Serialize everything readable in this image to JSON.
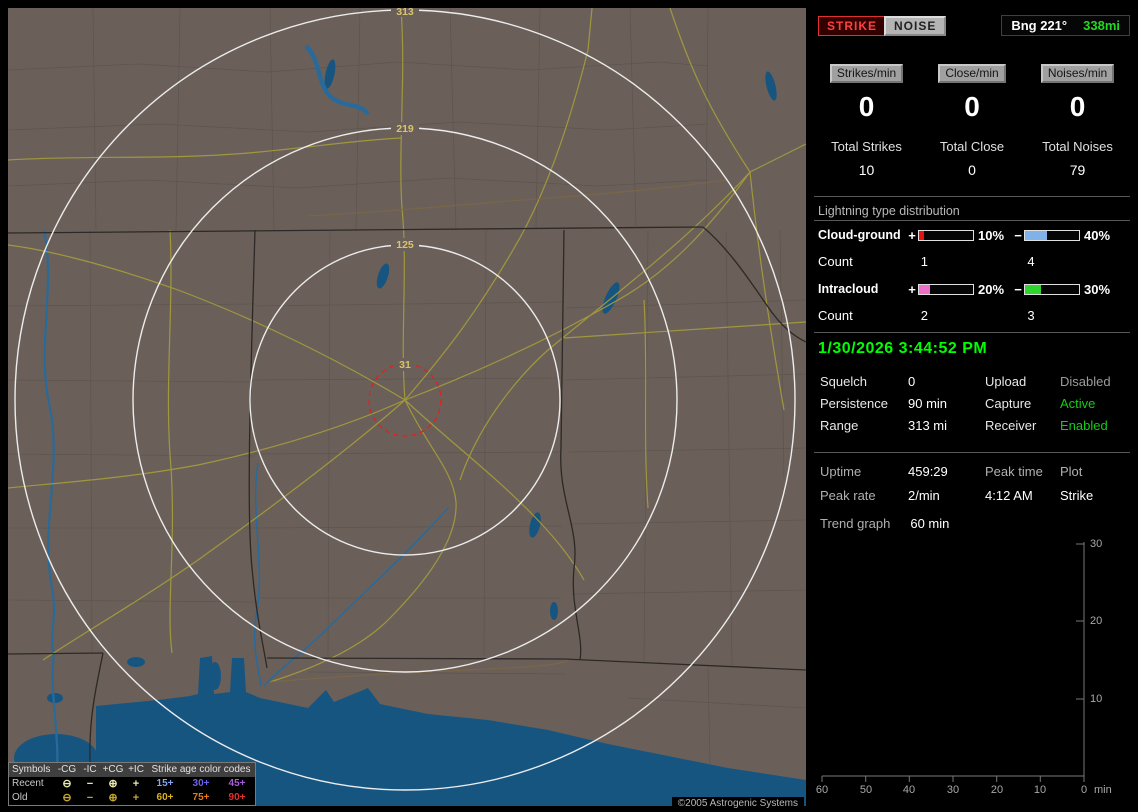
{
  "map": {
    "ring_labels": [
      "313",
      "219",
      "125",
      "31"
    ],
    "copyright": "©2005 Astrogenic Systems",
    "legend": {
      "headers": [
        "Symbols",
        "-CG",
        "-IC",
        "+CG",
        "+IC",
        "Strike age color codes"
      ],
      "rows": [
        {
          "label": "Recent",
          "sym_color": "#e9e9b0",
          "symbols": [
            "⊖",
            "−",
            "⊕",
            "+"
          ],
          "ages": [
            {
              "text": "15+",
              "color": "#86a7f0"
            },
            {
              "text": "30+",
              "color": "#6b63e6"
            },
            {
              "text": "45+",
              "color": "#a75bd8"
            }
          ]
        },
        {
          "label": "Old",
          "sym_color": "#c7a62e",
          "symbols": [
            "⊖",
            "−",
            "⊕",
            "+"
          ],
          "ages": [
            {
              "text": "60+",
              "color": "#d8b31f"
            },
            {
              "text": "75+",
              "color": "#e27c1e"
            },
            {
              "text": "90+",
              "color": "#e43030"
            }
          ]
        }
      ]
    }
  },
  "panel": {
    "strike_button": "STRIKE",
    "noise_button": "NOISE",
    "bearing": {
      "label": "Bng 221°",
      "distance": "338mi",
      "distance_color": "#21d921"
    },
    "rates": [
      {
        "badge": "Strikes/min",
        "value": "0",
        "total_label": "Total Strikes",
        "total_value": "10"
      },
      {
        "badge": "Close/min",
        "value": "0",
        "total_label": "Total Close",
        "total_value": "0"
      },
      {
        "badge": "Noises/min",
        "value": "0",
        "total_label": "Total Noises",
        "total_value": "79"
      }
    ],
    "distribution": {
      "heading": "Lightning type distribution",
      "rows": [
        {
          "label": "Cloud-ground",
          "sign1": "+",
          "pct1": "10%",
          "bar1_color": "#e81010",
          "sign2": "−",
          "pct2": "40%",
          "bar2_color": "#7fb2e8",
          "count_label": "Count",
          "count1": "1",
          "count2": "4"
        },
        {
          "label": "Intracloud",
          "sign1": "+",
          "pct1": "20%",
          "bar1_color": "#ee6ec8",
          "sign2": "−",
          "pct2": "30%",
          "bar2_color": "#2ed52e",
          "count_label": "Count",
          "count1": "2",
          "count2": "3"
        }
      ]
    },
    "datetime": {
      "text": "1/30/2026 3:44:52 PM",
      "color": "#00ff00"
    },
    "status": [
      {
        "label1": "Squelch",
        "value1": "0",
        "label2": "Upload",
        "value2": "Disabled",
        "value2_color": "#9c9c9c"
      },
      {
        "label1": "Persistence",
        "value1": "90 min",
        "label2": "Capture",
        "value2": "Active",
        "value2_color": "#15cc15"
      },
      {
        "label1": "Range",
        "value1": "313 mi",
        "label2": "Receiver",
        "value2": "Enabled",
        "value2_color": "#15cc15"
      }
    ],
    "info": {
      "uptime_label": "Uptime",
      "uptime_value": "459:29",
      "peakrate_label": "Peak rate",
      "peakrate_value": "2/min",
      "peaktime_label": "Peak time",
      "peaktime_value": "4:12 AM",
      "plot_label": "Plot",
      "plot_value": "Strike",
      "trend_label": "Trend graph",
      "trend_value": "60 min"
    },
    "trend_axes": {
      "yticks": [
        "30",
        "20",
        "10"
      ],
      "xticks": [
        "60",
        "50",
        "40",
        "30",
        "20",
        "10",
        "0"
      ],
      "unit": "min"
    }
  }
}
